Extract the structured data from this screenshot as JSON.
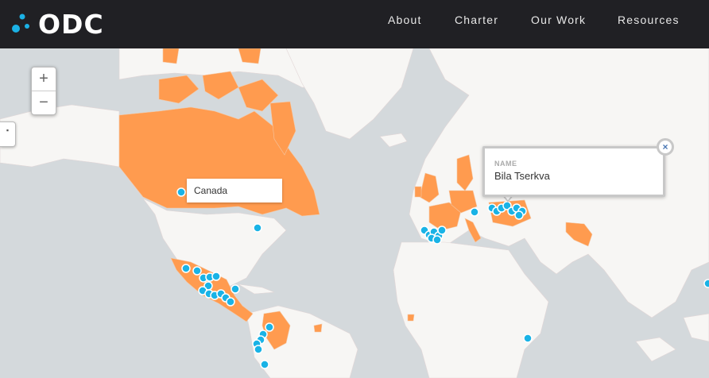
{
  "brand": {
    "name": "ODC"
  },
  "nav": {
    "items": [
      "About",
      "Charter",
      "Our Work",
      "Resources"
    ]
  },
  "map": {
    "colors": {
      "ocean": "#d4d9dc",
      "land": "#f7f6f4",
      "highlight": "#ff9b4f",
      "marker": "#19b3e6",
      "navbar": "#202024"
    },
    "zoom_in_label": "+",
    "zoom_out_label": "−",
    "hover_label": "Canada",
    "popup": {
      "field_label": "NAME",
      "field_value": "Bila Tserkva",
      "close_label": "×"
    }
  }
}
